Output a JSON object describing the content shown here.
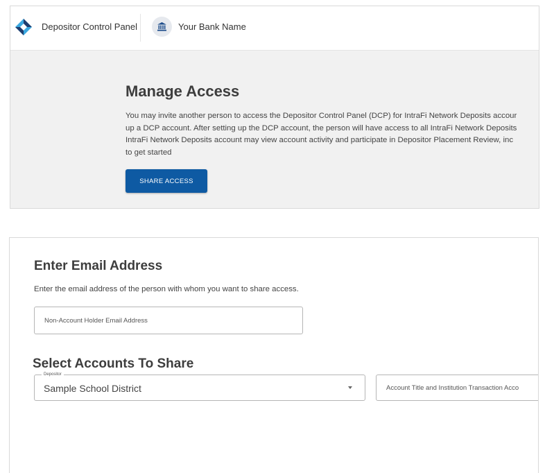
{
  "header": {
    "app_title": "Depositor Control Panel",
    "bank_name": "Your Bank Name",
    "logo_icon": "diamond-logo-icon",
    "bank_icon": "bank-icon"
  },
  "manage_access": {
    "title": "Manage Access",
    "description_lines": [
      "You may invite another person to access the Depositor Control Panel (DCP) for IntraFi Network Deposits accour",
      "up a DCP account. After setting up the DCP account, the person will have access to all IntraFi Network Deposits",
      "IntraFi Network Deposits account may view account activity and participate in Depositor Placement Review, inc",
      "to get started"
    ],
    "share_button_label": "SHARE ACCESS"
  },
  "email_section": {
    "title": "Enter Email Address",
    "description": "Enter the email address of the person with whom you want to share access.",
    "input_placeholder": "Non-Account Holder Email Address",
    "input_value": ""
  },
  "accounts_section": {
    "title": "Select Accounts To Share",
    "depositor_label": "Depositor",
    "depositor_value": "Sample School District",
    "account_placeholder": "Account Title and Institution Transaction Acco"
  },
  "colors": {
    "primary_button": "#0e5aa3",
    "panel_background": "#f1f1f1",
    "logo_dark": "#1f3d6e",
    "logo_light": "#3aa8e0"
  }
}
